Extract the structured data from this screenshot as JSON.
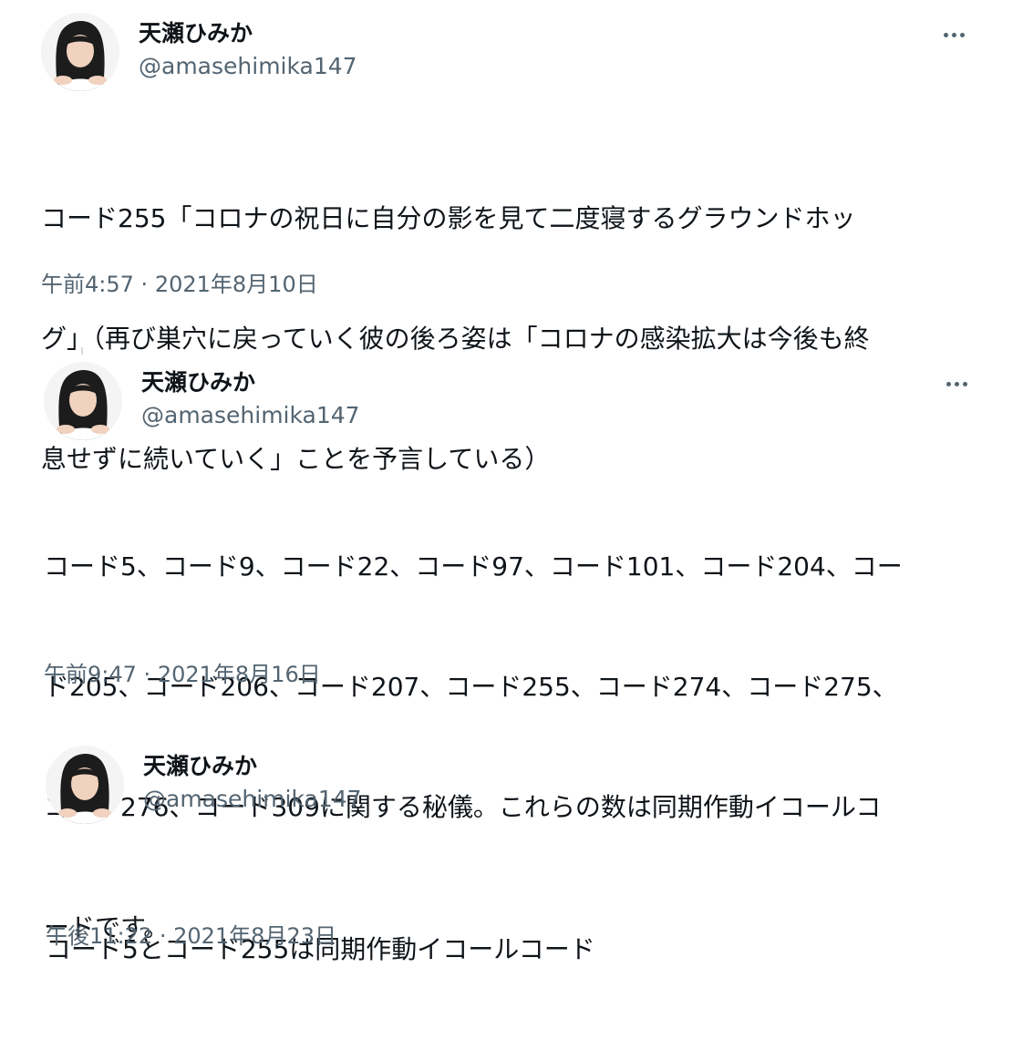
{
  "tweets": [
    {
      "name": "天瀬ひみか",
      "handle": "@amasehimika147",
      "text_lines": [
        "コード255「コロナの祝日に自分の影を見て二度寝するグラウンドホッ",
        "グ」（再び巣穴に戻っていく彼の後ろ姿は「コロナの感染拡大は今後も終",
        "息せずに続いていく」ことを予言している）"
      ],
      "time": "午前4:57",
      "date": "2021年8月10日",
      "separator": "·"
    },
    {
      "name": "天瀬ひみか",
      "handle": "@amasehimika147",
      "text_lines": [
        "コード5、コード9、コード22、コード97、コード101、コード204、コー",
        "ド205、コード206、コード207、コード255、コード274、コード275、",
        "コード276、コード309に関する秘儀。これらの数は同期作動イコールコ",
        "ードです。"
      ],
      "time": "午前9:47",
      "date": "2021年8月16日",
      "separator": "·"
    },
    {
      "name": "天瀬ひみか",
      "handle": "@amasehimika147",
      "text_lines": [
        "コード5とコード255は同期作動イコールコード"
      ],
      "time": "午後11:22",
      "date": "2021年8月23日",
      "separator": "·"
    }
  ],
  "icons": {
    "more": "more-options-icon",
    "avatar": "profile-avatar"
  },
  "colors": {
    "text": "#0f1419",
    "secondary": "#536471",
    "background": "#ffffff"
  }
}
